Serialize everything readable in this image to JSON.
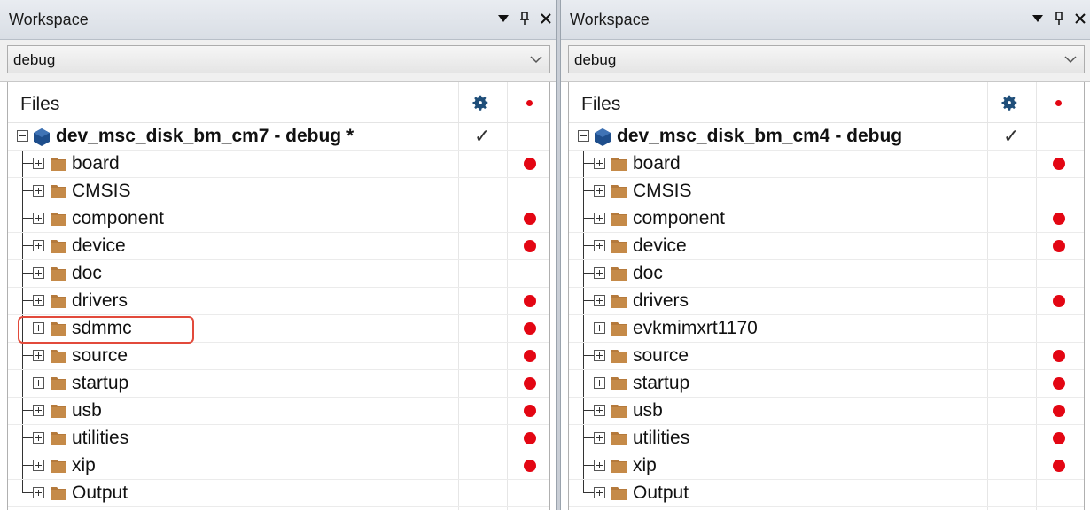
{
  "colors": {
    "dot": "#e30613",
    "folder": "#b57a3c",
    "project_icon": "#1e4e8c",
    "highlight": "#e24a3b"
  },
  "icons": {
    "pin": "pin-icon",
    "close": "close-icon",
    "menu": "dropdown-arrow-icon",
    "gear": "gear-icon",
    "check": "checkmark-icon"
  },
  "left_panel": {
    "title": "Workspace",
    "configuration": "debug",
    "header": {
      "files": "Files"
    },
    "project": {
      "name": "dev_msc_disk_bm_cm7 - debug *",
      "checked": true
    },
    "items": [
      {
        "label": "board",
        "dot": true
      },
      {
        "label": "CMSIS",
        "dot": false
      },
      {
        "label": "component",
        "dot": true
      },
      {
        "label": "device",
        "dot": true
      },
      {
        "label": "doc",
        "dot": false
      },
      {
        "label": "drivers",
        "dot": true
      },
      {
        "label": "sdmmc",
        "dot": true,
        "highlighted": true
      },
      {
        "label": "source",
        "dot": true
      },
      {
        "label": "startup",
        "dot": true
      },
      {
        "label": "usb",
        "dot": true
      },
      {
        "label": "utilities",
        "dot": true
      },
      {
        "label": "xip",
        "dot": true
      },
      {
        "label": "Output",
        "dot": false
      }
    ]
  },
  "right_panel": {
    "title": "Workspace",
    "configuration": "debug",
    "header": {
      "files": "Files"
    },
    "project": {
      "name": "dev_msc_disk_bm_cm4 - debug",
      "checked": true
    },
    "items": [
      {
        "label": "board",
        "dot": true
      },
      {
        "label": "CMSIS",
        "dot": false
      },
      {
        "label": "component",
        "dot": true
      },
      {
        "label": "device",
        "dot": true
      },
      {
        "label": "doc",
        "dot": false
      },
      {
        "label": "drivers",
        "dot": true
      },
      {
        "label": "evkmimxrt1170",
        "dot": false
      },
      {
        "label": "source",
        "dot": true
      },
      {
        "label": "startup",
        "dot": true
      },
      {
        "label": "usb",
        "dot": true
      },
      {
        "label": "utilities",
        "dot": true
      },
      {
        "label": "xip",
        "dot": true
      },
      {
        "label": "Output",
        "dot": false
      }
    ]
  }
}
